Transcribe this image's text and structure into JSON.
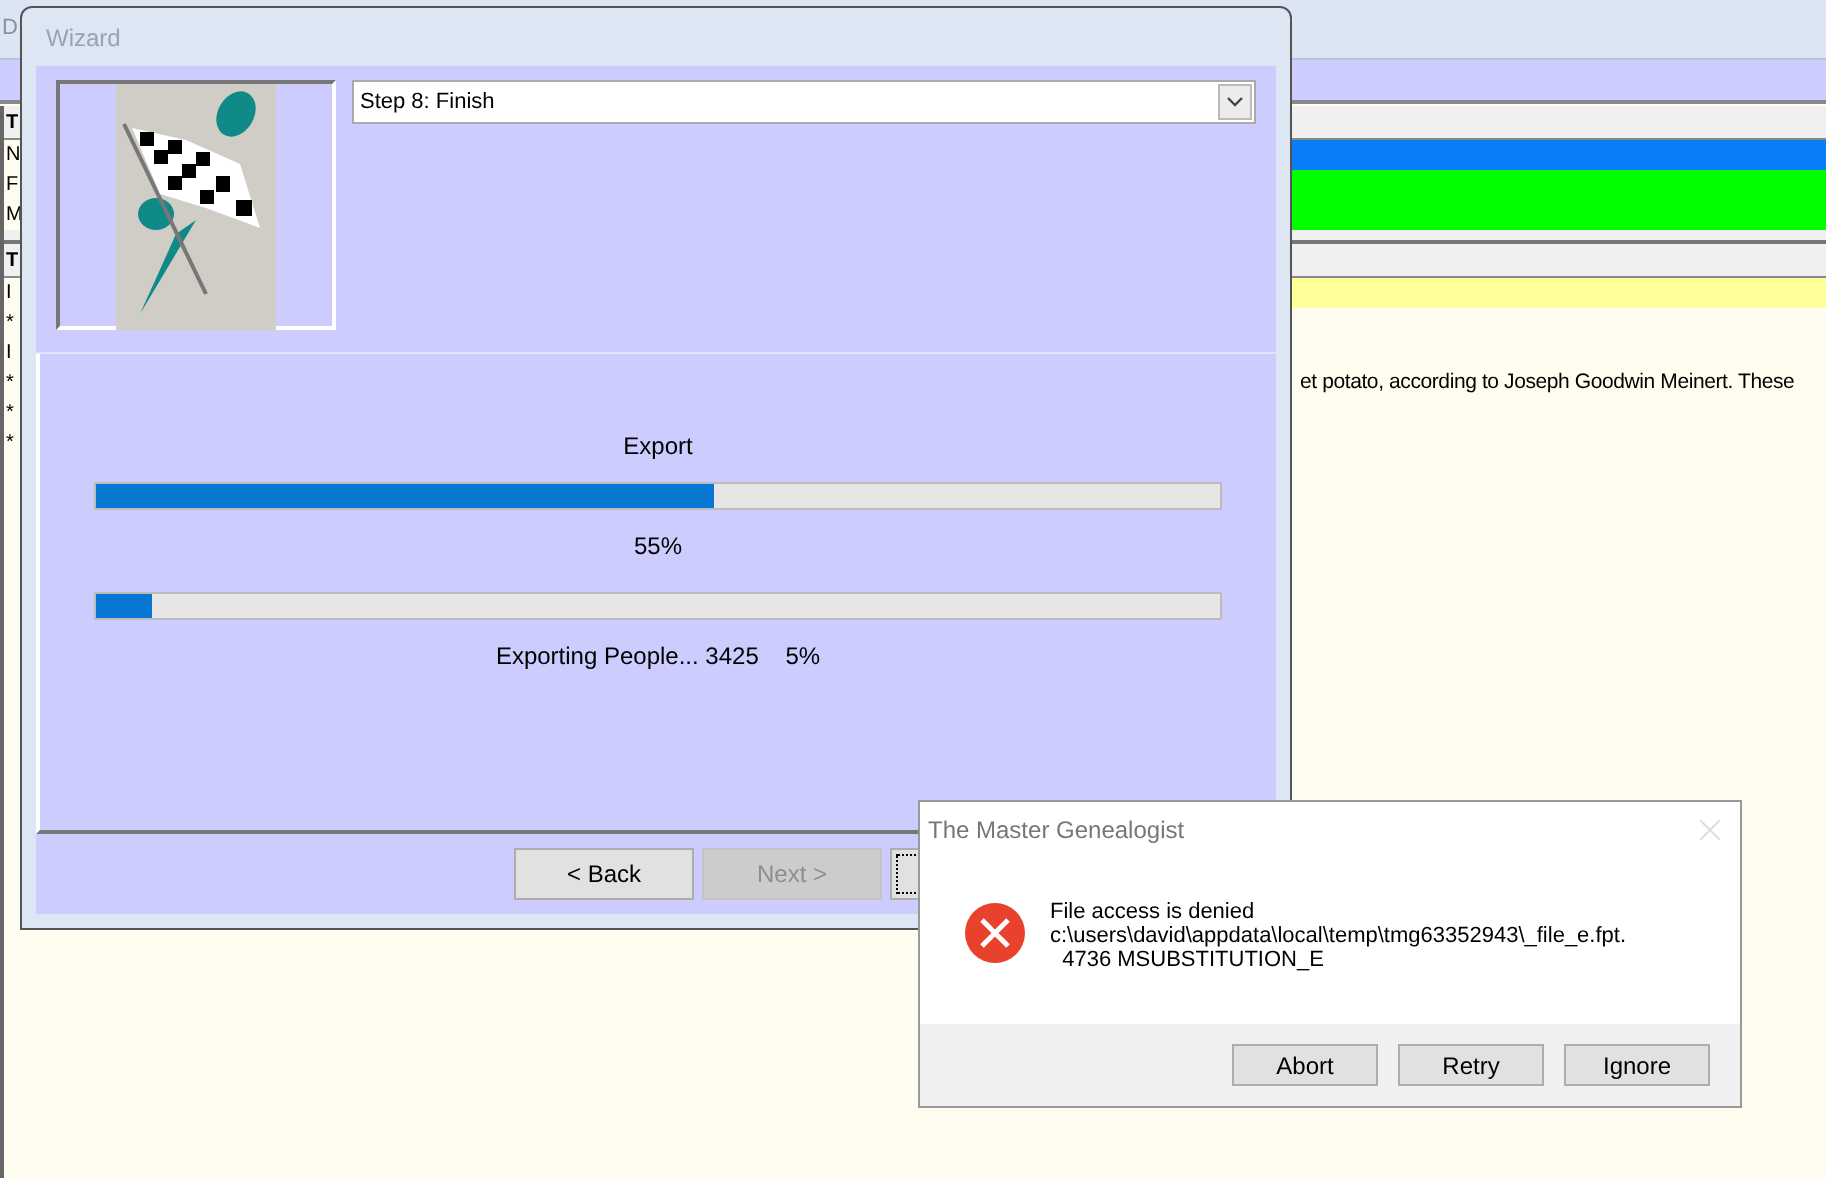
{
  "background_window": {
    "title": "D",
    "rows": [
      {
        "kind": "header",
        "letter": "T"
      },
      {
        "kind": "row",
        "letter": "N",
        "color": "#0a7cf6"
      },
      {
        "kind": "row",
        "letter": "F",
        "color": "#00ff00"
      },
      {
        "kind": "row",
        "letter": "M",
        "color": "#00ff00"
      },
      {
        "kind": "gap"
      },
      {
        "kind": "header",
        "letter": "T"
      },
      {
        "kind": "row",
        "letter": "I",
        "color": "#ffff99"
      },
      {
        "kind": "row",
        "letter": "*"
      },
      {
        "kind": "row",
        "letter": "I"
      },
      {
        "kind": "row",
        "letter": "*",
        "text": "et potato, according to Joseph Goodwin Meinert.  These"
      },
      {
        "kind": "row",
        "letter": "*"
      },
      {
        "kind": "row",
        "letter": "*"
      }
    ]
  },
  "wizard": {
    "title": "Wizard",
    "step": {
      "value": "Step 8: Finish"
    },
    "progress": [
      {
        "label": "Export",
        "level": 0.55,
        "reading": "55%"
      },
      {
        "level": 0.05,
        "reading": "Exporting People... 3425    5%"
      }
    ],
    "buttons": [
      {
        "label": "< Back",
        "disabled": false
      },
      {
        "label": "Next >",
        "disabled": true
      },
      {
        "disabled": false,
        "focused": true
      }
    ]
  },
  "message_box": {
    "title": "The Master Genealogist",
    "message": "File access is denied",
    "detail_lines": [
      "c:\\users\\david\\appdata\\local\\temp\\tmg63352943\\_file_e.fpt.",
      "  4736 MSUBSTITUTION_E"
    ],
    "buttons": [
      "Abort",
      "Retry",
      "Ignore"
    ]
  }
}
